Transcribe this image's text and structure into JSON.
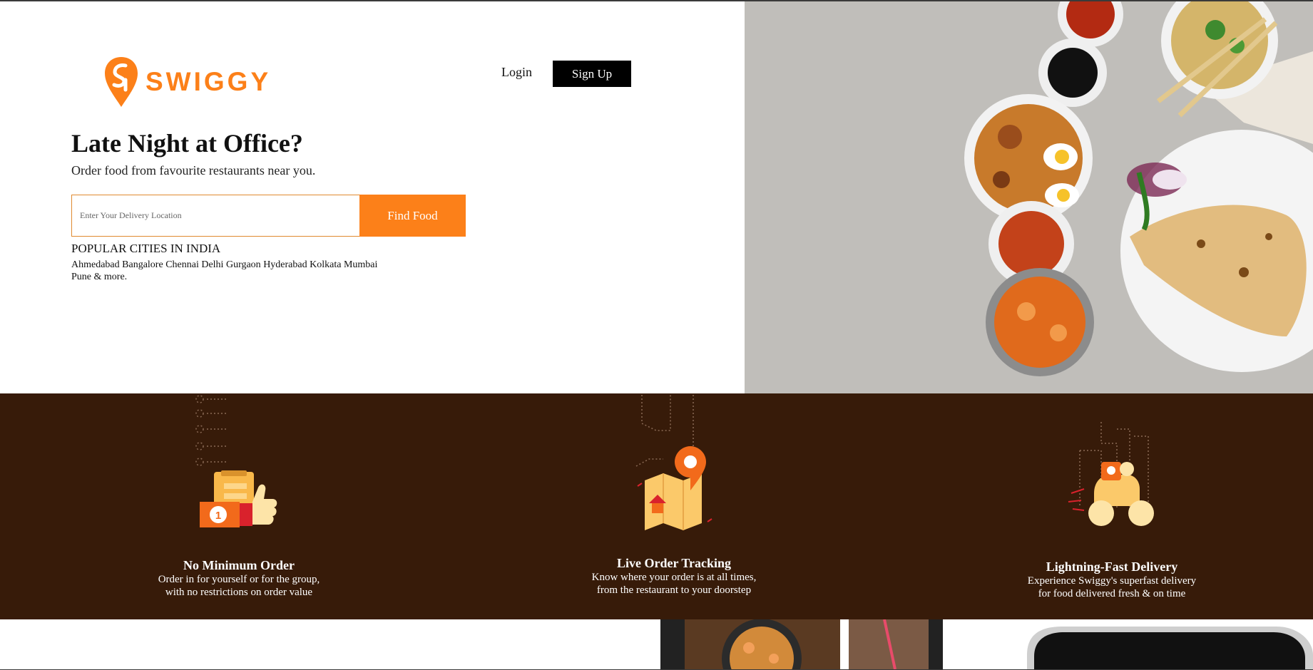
{
  "brand": {
    "name": "SWIGGY",
    "accent": "#fc8019",
    "dark": "#371b09"
  },
  "header": {
    "login_label": "Login",
    "signup_label": "Sign Up"
  },
  "hero": {
    "headline": "Late Night at Office?",
    "subheadline": "Order food from favourite restaurants near you.",
    "search": {
      "placeholder": "Enter Your Delivery Location",
      "value": "",
      "button_label": "Find Food"
    },
    "popular_cities": {
      "heading": "POPULAR CITIES IN INDIA",
      "cities": [
        "Ahmedabad",
        "Bangalore",
        "Chennai",
        "Delhi",
        "Gurgaon",
        "Hyderabad",
        "Kolkata",
        "Mumbai",
        "Pune"
      ],
      "more": "& more."
    }
  },
  "features": [
    {
      "title": "No Minimum Order",
      "description": "Order in for yourself or for the group,\nwith no restrictions on order value",
      "icon": "thumbs-up-order-icon"
    },
    {
      "title": "Live Order Tracking",
      "description": "Know where your order is at all times,\nfrom the restaurant to your doorstep",
      "icon": "map-tracking-icon"
    },
    {
      "title": "Lightning-Fast Delivery",
      "description": "Experience Swiggy's superfast delivery\nfor food delivered fresh & on time",
      "icon": "delivery-scooter-icon"
    }
  ]
}
